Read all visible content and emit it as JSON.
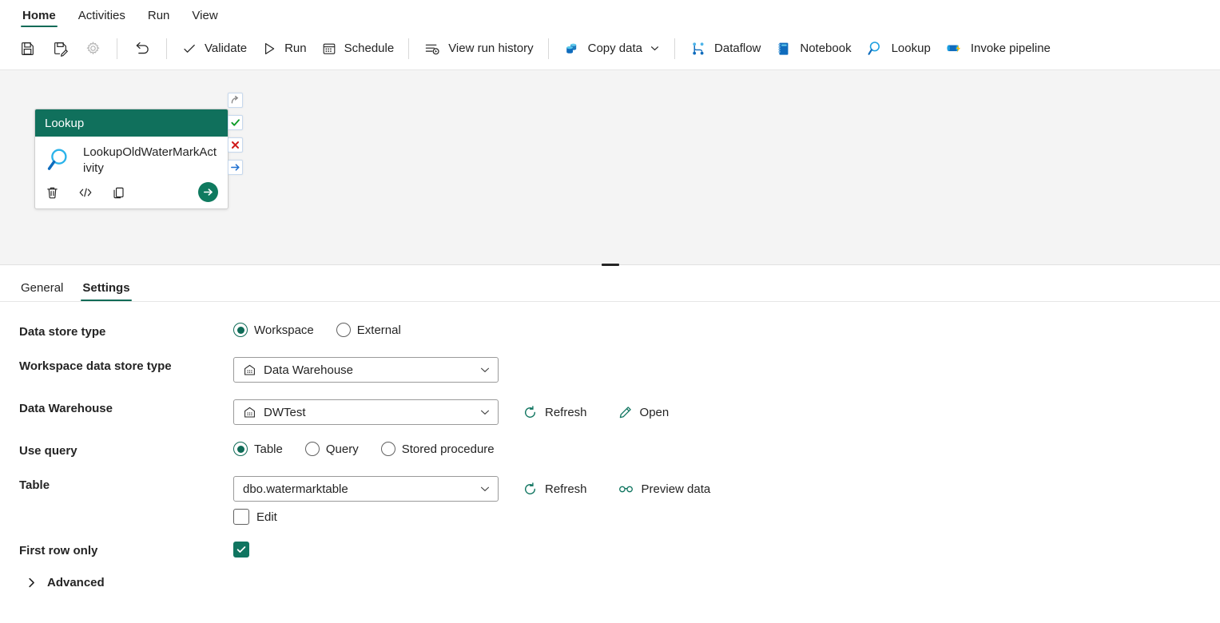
{
  "ribbon": {
    "tabs": [
      {
        "label": "Home",
        "active": true
      },
      {
        "label": "Activities",
        "active": false
      },
      {
        "label": "Run",
        "active": false
      },
      {
        "label": "View",
        "active": false
      }
    ]
  },
  "toolbar": {
    "save_tooltip": "Save",
    "save_as_tooltip": "Save as",
    "settings_tooltip": "Settings",
    "undo_tooltip": "Undo",
    "validate_label": "Validate",
    "run_label": "Run",
    "schedule_label": "Schedule",
    "view_run_history_label": "View run history",
    "copy_data_label": "Copy data",
    "dataflow_label": "Dataflow",
    "notebook_label": "Notebook",
    "lookup_label": "Lookup",
    "invoke_pipeline_label": "Invoke pipeline"
  },
  "canvas": {
    "activity": {
      "type_label": "Lookup",
      "name": "LookupOldWaterMarkActivity",
      "delete_tooltip": "Delete",
      "code_tooltip": "View code",
      "duplicate_tooltip": "Duplicate",
      "run_tooltip": "Run"
    },
    "handles": [
      {
        "name": "on-skip",
        "tooltip": "On skip"
      },
      {
        "name": "on-success",
        "tooltip": "On success"
      },
      {
        "name": "on-fail",
        "tooltip": "On fail"
      },
      {
        "name": "on-completion",
        "tooltip": "On completion"
      }
    ]
  },
  "property_tabs": [
    {
      "label": "General",
      "active": false
    },
    {
      "label": "Settings",
      "active": true
    }
  ],
  "settings": {
    "data_store_type": {
      "label": "Data store type",
      "options": [
        "Workspace",
        "External"
      ],
      "selected": "Workspace"
    },
    "workspace_data_store_type": {
      "label": "Workspace data store type",
      "value": "Data Warehouse"
    },
    "data_warehouse": {
      "label": "Data Warehouse",
      "value": "DWTest",
      "refresh_label": "Refresh",
      "open_label": "Open"
    },
    "use_query": {
      "label": "Use query",
      "options": [
        "Table",
        "Query",
        "Stored procedure"
      ],
      "selected": "Table"
    },
    "table": {
      "label": "Table",
      "value": "dbo.watermarktable",
      "refresh_label": "Refresh",
      "preview_label": "Preview data",
      "edit_label": "Edit",
      "edit_checked": false
    },
    "first_row_only": {
      "label": "First row only",
      "checked": true
    },
    "advanced": {
      "label": "Advanced",
      "expanded": false
    }
  },
  "colors": {
    "accent_teal": "#0f6b57",
    "card_header": "#10705c",
    "blue_icon": "#0f6cbd",
    "canvas_bg": "#f4f4f4"
  }
}
